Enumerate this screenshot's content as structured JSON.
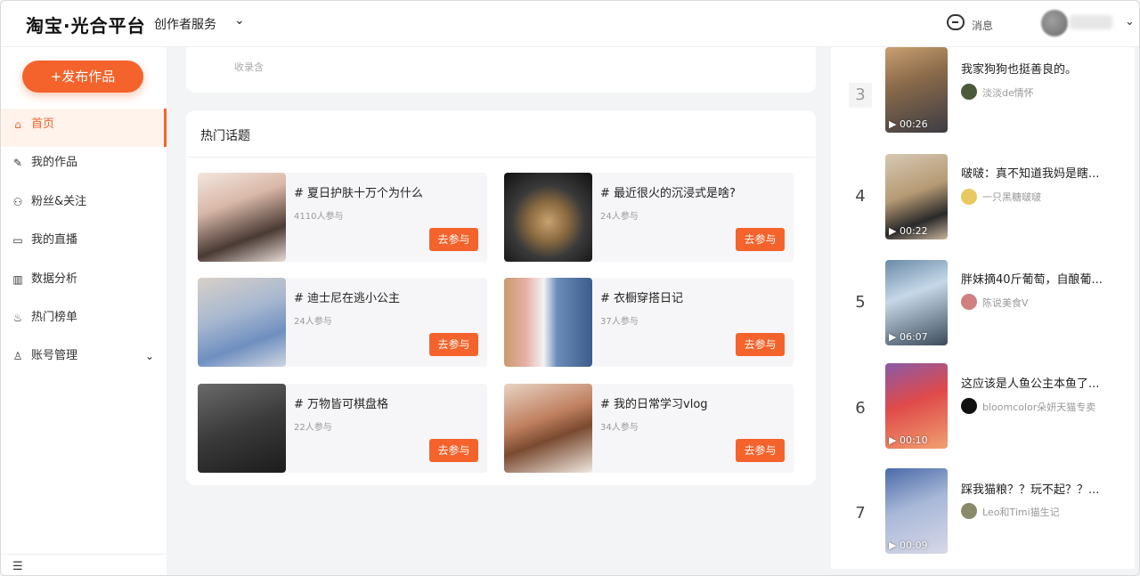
{
  "header": {
    "logo": "淘宝·光合平台",
    "service": "创作者服务",
    "messages": "消息"
  },
  "sidebar": {
    "publish": "+发布作品",
    "items": [
      {
        "label": "首页",
        "icon": "home-icon",
        "glyph": "⌂",
        "active": true
      },
      {
        "label": "我的作品",
        "icon": "pen-icon",
        "glyph": "✎",
        "active": false
      },
      {
        "label": "粉丝&关注",
        "icon": "people-icon",
        "glyph": "⚇",
        "active": false
      },
      {
        "label": "我的直播",
        "icon": "video-icon",
        "glyph": "▭",
        "active": false
      },
      {
        "label": "数据分析",
        "icon": "chart-icon",
        "glyph": "▥",
        "active": false
      },
      {
        "label": "热门榜单",
        "icon": "flame-icon",
        "glyph": "♨",
        "active": false
      },
      {
        "label": "账号管理",
        "icon": "user-icon",
        "glyph": "♙",
        "active": false
      }
    ]
  },
  "top_card": {
    "faded": "收录含"
  },
  "topics": {
    "title": "热门话题",
    "join_label": "去参与",
    "items": [
      {
        "name": "#   夏日护肤十万个为什么",
        "count": "4110人参与"
      },
      {
        "name": "#   最近很火的沉浸式是啥?",
        "count": "24人参与"
      },
      {
        "name": "#   迪士尼在逃小公主",
        "count": "24人参与"
      },
      {
        "name": "#   衣橱穿搭日记",
        "count": "37人参与"
      },
      {
        "name": "#   万物皆可棋盘格",
        "count": "22人参与"
      },
      {
        "name": "#   我的日常学习vlog",
        "count": "34人参与"
      }
    ]
  },
  "ranking": {
    "items": [
      {
        "rank": "3",
        "time": "00:26",
        "title": "我家狗狗也挺善良的。",
        "author": "淡淡de情怀"
      },
      {
        "rank": "4",
        "time": "00:22",
        "title": "啵啵：真不知道我妈是瞎...",
        "author": "一只黑糖啵啵"
      },
      {
        "rank": "5",
        "time": "06:07",
        "title": "胖妹摘40斤葡萄，自酿葡...",
        "author": "陈说美食V"
      },
      {
        "rank": "6",
        "time": "00:10",
        "title": "这应该是人鱼公主本鱼了...",
        "author": "bloomcolor朵妍天猫专卖"
      },
      {
        "rank": "7",
        "time": "00:09",
        "title": "踩我猫粮？？玩不起？？...",
        "author": "Leo和Timi猫生记"
      }
    ]
  }
}
